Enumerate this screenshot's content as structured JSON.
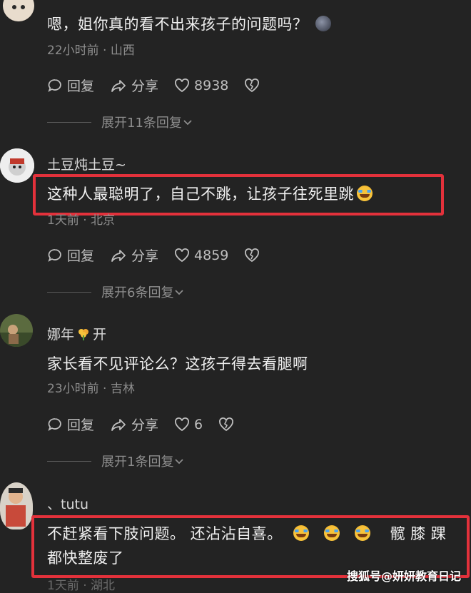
{
  "comments": [
    {
      "name": "",
      "content": "嗯，姐你真的看不出来孩子的问题吗？",
      "meta": "22小时前 · 山西",
      "reply": "回复",
      "share": "分享",
      "likes": "8938",
      "expand": "展开11条回复"
    },
    {
      "name": "土豆炖土豆~",
      "content": "这种人最聪明了，自己不跳，让孩子往死里跳",
      "meta": "1天前 · 北京",
      "reply": "回复",
      "share": "分享",
      "likes": "4859",
      "expand": "展开6条回复"
    },
    {
      "name": "娜年",
      "name_suffix": "开",
      "content": "家长看不见评论么？这孩子得去看腿啊",
      "meta": "23小时前 · 吉林",
      "reply": "回复",
      "share": "分享",
      "likes": "6",
      "expand": "展开1条回复"
    },
    {
      "name": "、tutu",
      "content_line1": "不赶紧看下肢问题。 还沾沾自喜。",
      "content_line1_tail": "髋 膝 踝",
      "content_line2": "都快整废了",
      "meta": "1天前 · 湖北"
    }
  ],
  "watermark": "搜狐号@妍妍教育日记",
  "colors": {
    "background": "#232323",
    "highlight": "#e3313b",
    "text": "#f0f0f0",
    "muted": "#8d8d8d"
  },
  "icons": {
    "reply": "comment-bubble-icon",
    "share": "share-arrow-icon",
    "like": "heart-icon",
    "dislike": "broken-heart-icon",
    "expand": "chevron-down-icon"
  }
}
